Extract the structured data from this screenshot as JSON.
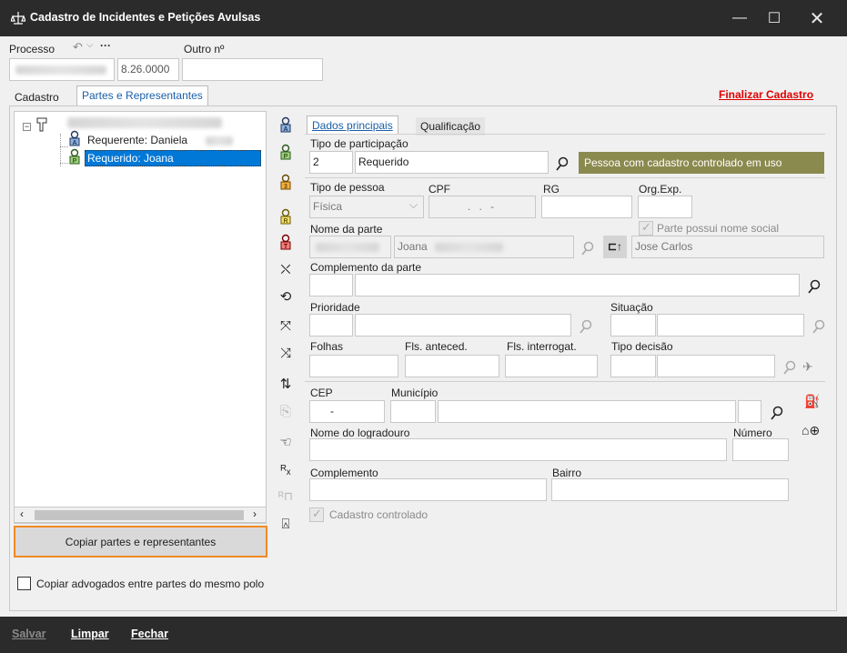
{
  "window": {
    "title": "Cadastro de Incidentes e Petições Avulsas"
  },
  "process": {
    "label": "Processo",
    "number_visible": "8.26.0000",
    "outro_label": "Outro nº",
    "outro_value": ""
  },
  "tabs": {
    "cadastro": "Cadastro",
    "partes": "Partes e Representantes"
  },
  "finalizar": "Finalizar Cadastro",
  "tree": {
    "item1": "Requerente: Daniela",
    "item2": "Requerido: Joana"
  },
  "copy_button": "Copiar partes e representantes",
  "copy_advogados_label": "Copiar advogados entre partes do mesmo polo",
  "inner_tabs": {
    "dados": "Dados principais",
    "qualificacao": "Qualificação"
  },
  "form": {
    "tipo_participacao_label": "Tipo de participação",
    "tipo_participacao_code": "2",
    "tipo_participacao_value": "Requerido",
    "pessoa_button": "Pessoa com cadastro controlado em uso",
    "tipo_pessoa_label": "Tipo de pessoa",
    "tipo_pessoa_value": "Física",
    "cpf_label": "CPF",
    "cpf_value": ". . -",
    "rg_label": "RG",
    "orgexp_label": "Org.Exp.",
    "nome_social_check": "Parte possui nome social",
    "nome_parte_label": "Nome da parte",
    "nome_parte_value": "Joana",
    "nome_social_value": "Jose Carlos",
    "complemento_parte_label": "Complemento da parte",
    "prioridade_label": "Prioridade",
    "situacao_label": "Situação",
    "folhas_label": "Folhas",
    "fls_anteced_label": "Fls. anteced.",
    "fls_interrogat_label": "Fls. interrogat.",
    "tipo_decisao_label": "Tipo decisão",
    "cep_label": "CEP",
    "cep_value": "-",
    "municipio_label": "Município",
    "logradouro_label": "Nome do logradouro",
    "numero_label": "Número",
    "complemento_label": "Complemento",
    "bairro_label": "Bairro",
    "cadastro_controlado_label": "Cadastro controlado"
  },
  "footer": {
    "salvar": "Salvar",
    "limpar": "Limpar",
    "fechar": "Fechar"
  },
  "colors": {
    "titlebar": "#2b2b2b",
    "accent": "#1a5fa8",
    "danger": "#e00000",
    "olive": "#8a8a4f",
    "highlight": "#f08a24",
    "selection": "#0078d7"
  }
}
